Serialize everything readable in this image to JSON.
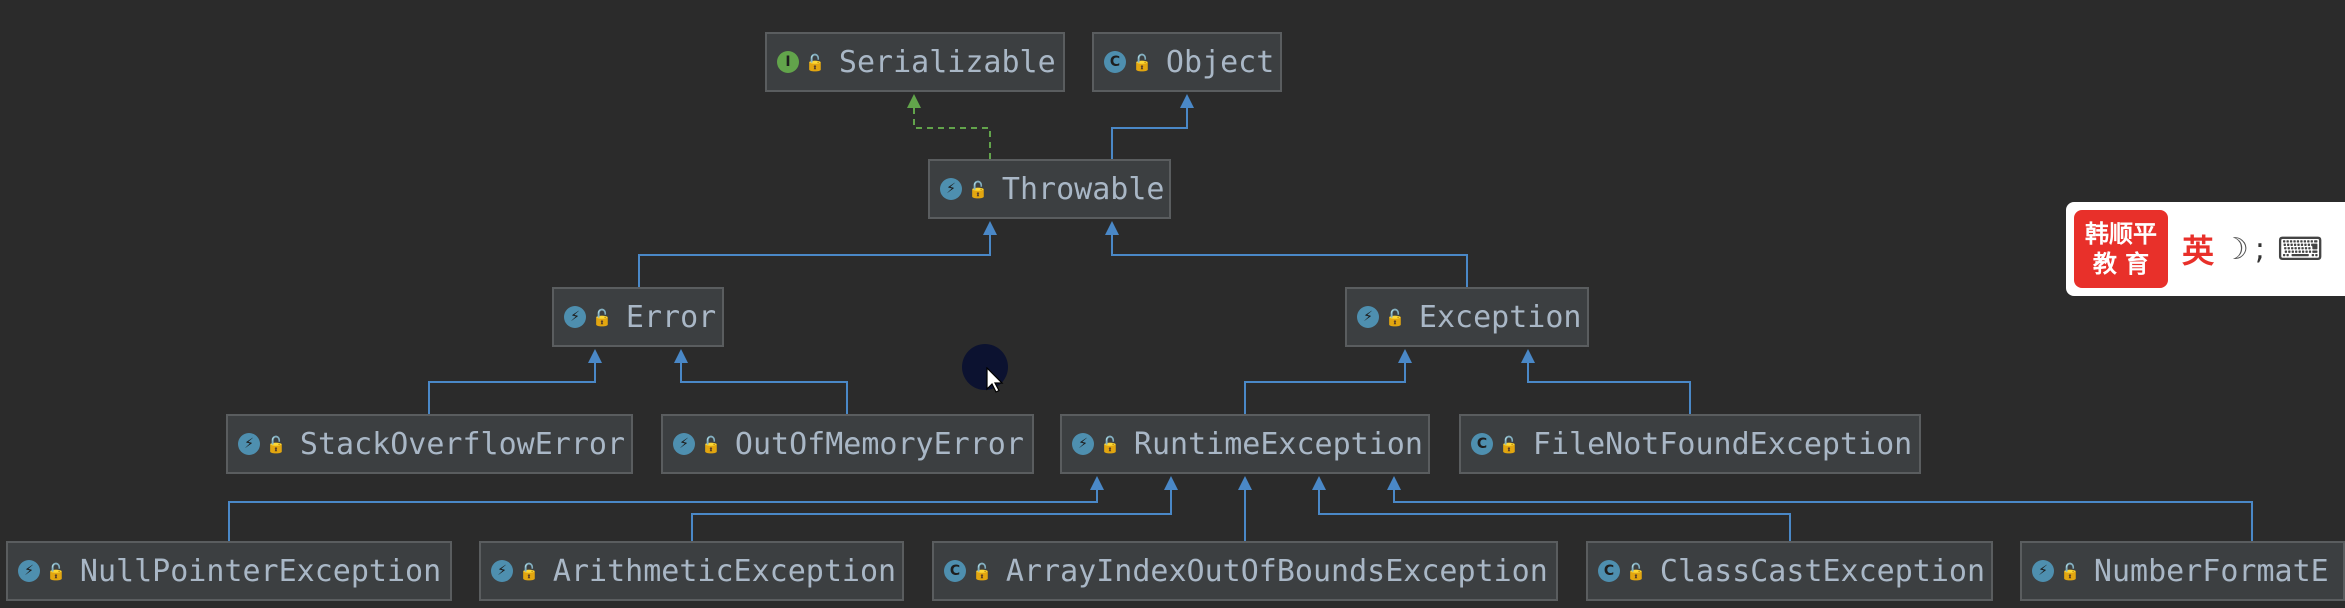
{
  "diagram": {
    "nodes": [
      {
        "id": "serializable",
        "label": "Serializable",
        "kind": "interface"
      },
      {
        "id": "object",
        "label": "Object",
        "kind": "class"
      },
      {
        "id": "throwable",
        "label": "Throwable",
        "kind": "throwable"
      },
      {
        "id": "error",
        "label": "Error",
        "kind": "throwable"
      },
      {
        "id": "exception",
        "label": "Exception",
        "kind": "throwable"
      },
      {
        "id": "stackoverflowerror",
        "label": "StackOverflowError",
        "kind": "throwable"
      },
      {
        "id": "outofmemoryerror",
        "label": "OutOfMemoryError",
        "kind": "throwable"
      },
      {
        "id": "runtimeexception",
        "label": "RuntimeException",
        "kind": "throwable"
      },
      {
        "id": "filenotfoundexception",
        "label": "FileNotFoundException",
        "kind": "class"
      },
      {
        "id": "nullpointerexception",
        "label": "NullPointerException",
        "kind": "throwable"
      },
      {
        "id": "arithmeticexception",
        "label": "ArithmeticException",
        "kind": "throwable"
      },
      {
        "id": "arrayindexoutofboundsexception",
        "label": "ArrayIndexOutOfBoundsException",
        "kind": "class"
      },
      {
        "id": "classcastexception",
        "label": "ClassCastException",
        "kind": "class"
      },
      {
        "id": "numberformatexception",
        "label": "NumberFormatE",
        "kind": "throwable"
      }
    ],
    "edges": [
      {
        "from": "throwable",
        "to": "serializable",
        "type": "implements"
      },
      {
        "from": "throwable",
        "to": "object",
        "type": "extends"
      },
      {
        "from": "error",
        "to": "throwable",
        "type": "extends"
      },
      {
        "from": "exception",
        "to": "throwable",
        "type": "extends"
      },
      {
        "from": "stackoverflowerror",
        "to": "error",
        "type": "extends"
      },
      {
        "from": "outofmemoryerror",
        "to": "error",
        "type": "extends"
      },
      {
        "from": "runtimeexception",
        "to": "exception",
        "type": "extends"
      },
      {
        "from": "filenotfoundexception",
        "to": "exception",
        "type": "extends"
      },
      {
        "from": "nullpointerexception",
        "to": "runtimeexception",
        "type": "extends"
      },
      {
        "from": "arithmeticexception",
        "to": "runtimeexception",
        "type": "extends"
      },
      {
        "from": "arrayindexoutofboundsexception",
        "to": "runtimeexception",
        "type": "extends"
      },
      {
        "from": "classcastexception",
        "to": "runtimeexception",
        "type": "extends"
      },
      {
        "from": "numberformatexception",
        "to": "runtimeexception",
        "type": "extends"
      }
    ],
    "kind_icons": {
      "interface": "I",
      "class": "C",
      "throwable": "⚡"
    },
    "colors": {
      "background": "#2b2b2b",
      "node_fill": "#3c3f41",
      "node_border": "#5a5d5f",
      "node_text": "#a9b7c6",
      "extends_edge": "#4a88c7",
      "implements_edge": "#62a44b"
    }
  },
  "watermark": {
    "logo_line1": "韩顺平",
    "logo_line2": "教 育",
    "lang": "英",
    "moon_icon": "☽",
    "punct": ";",
    "keyboard_icon": "⌨"
  }
}
